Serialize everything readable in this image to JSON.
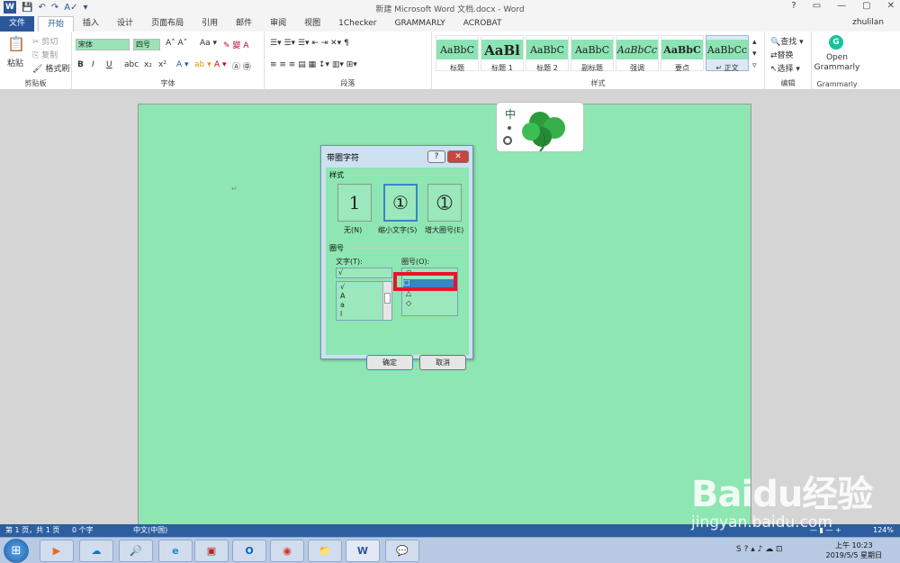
{
  "window": {
    "title": "新建 Microsoft Word 文档.docx - Word",
    "controls": [
      "?",
      "▭",
      "—",
      "▢",
      "✕"
    ]
  },
  "quick_access": {
    "icons": [
      "save-icon",
      "undo-icon",
      "redo-icon",
      "spell-icon",
      "customize-icon"
    ]
  },
  "user": "zhulilan",
  "tabs": [
    "文件",
    "开始",
    "插入",
    "设计",
    "页面布局",
    "引用",
    "邮件",
    "审阅",
    "视图",
    "1Checker",
    "GRAMMARLY",
    "ACROBAT"
  ],
  "ribbon": {
    "clipboard": {
      "paste": "粘贴",
      "cut": "剪切",
      "copy": "复制",
      "format_painter": "格式刷",
      "label": "剪贴板"
    },
    "font": {
      "name": "宋体",
      "size": "四号",
      "label": "字体",
      "buttons": [
        "B",
        "I",
        "U",
        "abc",
        "x₂",
        "x²"
      ]
    },
    "paragraph": {
      "label": "段落"
    },
    "styles": {
      "label": "样式",
      "items": [
        {
          "sample": "AaBbC",
          "name": "标题"
        },
        {
          "sample": "AaBl",
          "name": "标题 1"
        },
        {
          "sample": "AaBbC",
          "name": "标题 2"
        },
        {
          "sample": "AaBbC",
          "name": "副标题"
        },
        {
          "sample": "AaBbCc",
          "name": "强调"
        },
        {
          "sample": "AaBbC",
          "name": "要点"
        },
        {
          "sample": "AaBbCc",
          "name": "↵ 正文"
        }
      ]
    },
    "editing": {
      "find": "查找",
      "replace": "替换",
      "select": "选择",
      "label": "编辑"
    },
    "grammarly": {
      "open": "Open",
      "name": "Grammarly",
      "label": "Grammarly"
    }
  },
  "document": {
    "paragraph_mark": "↵",
    "overlay_text": "中"
  },
  "dialog": {
    "title": "带圈字符",
    "help": "?",
    "close": "✕",
    "style_section": "样式",
    "options": [
      {
        "glyph": "1",
        "label": "无(N)",
        "selected": false
      },
      {
        "glyph": "①",
        "label": "缩小文字(S)",
        "selected": true
      },
      {
        "glyph": "➀",
        "label": "增大圈号(E)",
        "selected": false
      }
    ],
    "circle_section": "圈号",
    "text_label": "文字(T):",
    "text_value": "√",
    "text_list": [
      "√",
      "A",
      "a",
      "l"
    ],
    "enclosure_label": "圈号(O):",
    "enclosure_list": [
      "○",
      "□",
      "△",
      "◇"
    ],
    "ok": "确定",
    "cancel": "取消"
  },
  "status": {
    "page": "第 1 页，共 1 页",
    "words": "0 个字",
    "language": "中文(中国)",
    "zoom": "124%"
  },
  "taskbar": {
    "apps": [
      "start-orb",
      "media-player",
      "baidu-cloud",
      "search-tool",
      "ie-browser",
      "remote-desktop",
      "outlook",
      "chrome",
      "file-explorer",
      "word",
      "wechat"
    ],
    "time": "上午 10:23",
    "date": "2019/5/5 星期日"
  },
  "watermark": {
    "logo": "Baidu经验",
    "url": "jingyan.baidu.com"
  },
  "colors": {
    "accent": "#2b579a",
    "page": "#8ee6b2",
    "highlight": "#e8142c",
    "selection": "#3b83c6"
  }
}
